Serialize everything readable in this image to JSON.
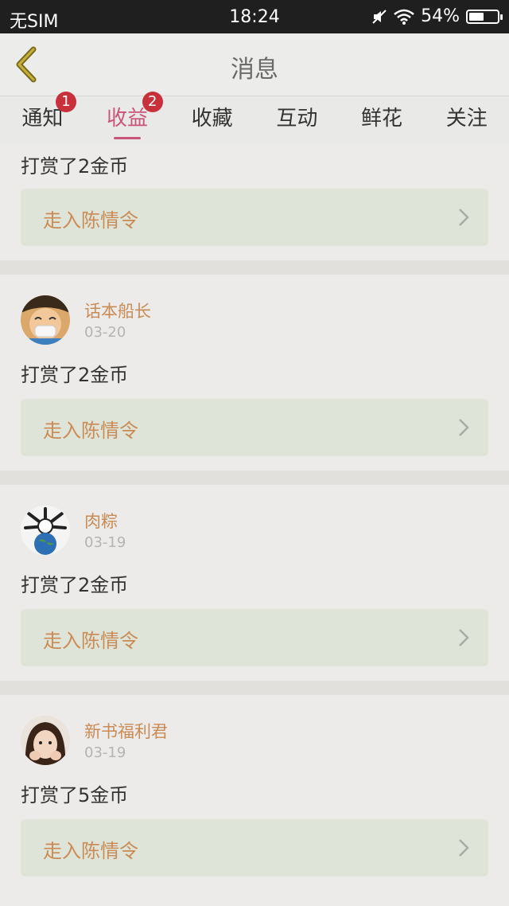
{
  "status_bar": {
    "carrier": "无SIM",
    "time": "18:24",
    "battery": "54%",
    "battery_level": 0.54
  },
  "nav": {
    "title": "消息"
  },
  "tabs": [
    {
      "label": "通知",
      "badge": "1"
    },
    {
      "label": "收益",
      "badge": "2"
    },
    {
      "label": "收藏"
    },
    {
      "label": "互动"
    },
    {
      "label": "鲜花"
    },
    {
      "label": "关注"
    }
  ],
  "items": [
    {
      "message": "打赏了2金币",
      "book": "走入陈情令"
    },
    {
      "user": "话本船长",
      "date": "03-20",
      "message": "打赏了2金币",
      "book": "走入陈情令"
    },
    {
      "user": "肉粽",
      "date": "03-19",
      "message": "打赏了2金币",
      "book": "走入陈情令"
    },
    {
      "user": "新书福利君",
      "date": "03-19",
      "message": "打赏了5金币",
      "book": "走入陈情令"
    }
  ],
  "colors": {
    "accent": "#c9557b",
    "badge": "#c8303b",
    "link_text": "#c98b56",
    "link_bg": "#dfe4d8"
  }
}
